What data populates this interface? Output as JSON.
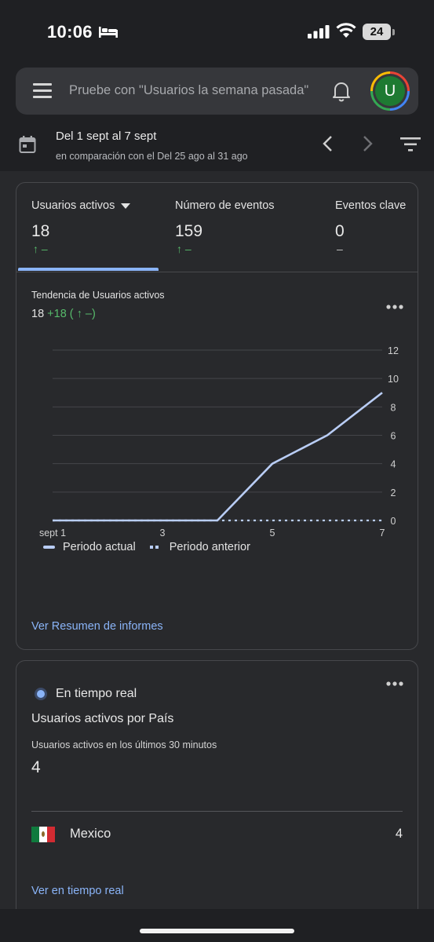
{
  "status_bar": {
    "time": "10:06",
    "battery": "24"
  },
  "search": {
    "placeholder": "Pruebe con \"Usuarios la semana pasada\""
  },
  "avatar": {
    "initial": "U"
  },
  "date_range": {
    "main": "Del 1 sept al 7 sept",
    "comparison": "en comparación con el Del 25 ago al 31 ago"
  },
  "metrics": [
    {
      "label": "Usuarios activos",
      "value": "18",
      "change": "↑ –"
    },
    {
      "label": "Número de eventos",
      "value": "159",
      "change": "↑ –"
    },
    {
      "label": "Eventos clave",
      "value": "0",
      "change": "–"
    }
  ],
  "trend": {
    "title": "Tendencia de Usuarios activos",
    "value": "18",
    "delta": "+18 ( ↑ –)",
    "link": "Ver Resumen de informes"
  },
  "chart_data": {
    "type": "line",
    "x": [
      1,
      2,
      3,
      4,
      5,
      6,
      7
    ],
    "x_tick_labels": [
      "sept 1",
      "3",
      "5",
      "7"
    ],
    "x_tick_positions": [
      1,
      3,
      5,
      7
    ],
    "ylim": [
      0,
      12
    ],
    "y_ticks": [
      0,
      2,
      4,
      6,
      8,
      10,
      12
    ],
    "y_axis_position": "right",
    "grid": true,
    "series": [
      {
        "name": "Periodo actual",
        "values": [
          0,
          0,
          0,
          0,
          4,
          6,
          9
        ],
        "style": "solid",
        "color": "#b9cdf5"
      },
      {
        "name": "Periodo anterior",
        "values": [
          0,
          0,
          0,
          0,
          0,
          0,
          0
        ],
        "style": "dashed",
        "color": "#b9cdf5"
      }
    ]
  },
  "realtime": {
    "label": "En tiempo real",
    "title": "Usuarios activos por País",
    "subtitle": "Usuarios activos en los últimos 30 minutos",
    "count": "4",
    "rows": [
      {
        "country": "Mexico",
        "value": "4"
      }
    ],
    "link": "Ver en tiempo real"
  },
  "colors": {
    "background": "#1f2023",
    "card": "#28292c",
    "accent_blue": "#8ab4f8",
    "positive_green": "#57bb6b"
  }
}
